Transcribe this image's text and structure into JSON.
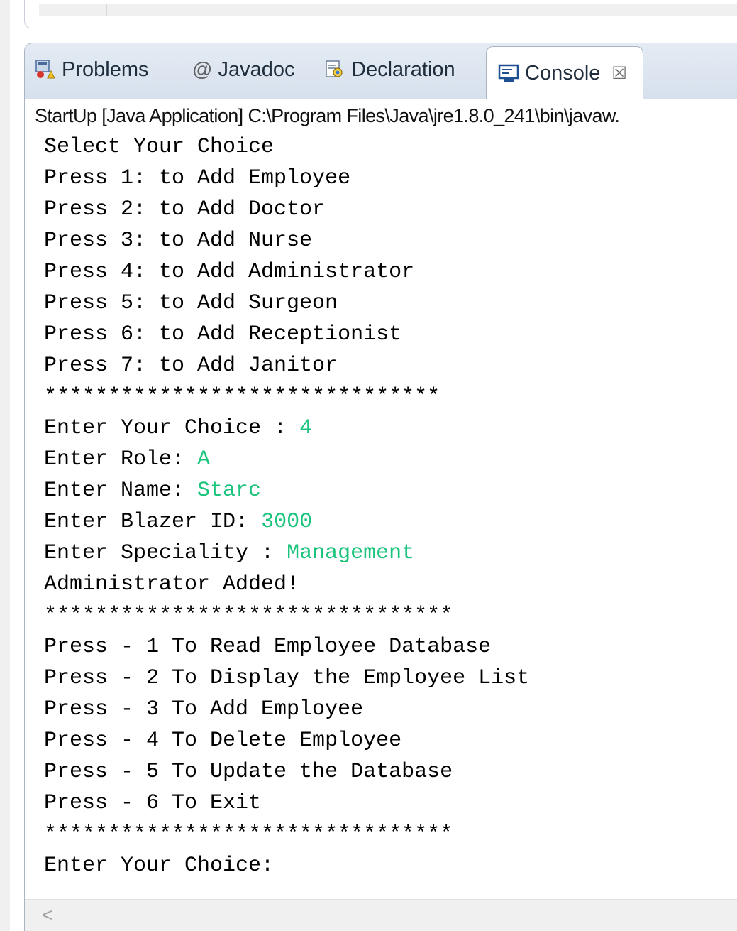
{
  "tabs": {
    "problems": "Problems",
    "javadoc": "Javadoc",
    "declaration": "Declaration",
    "console": "Console",
    "console_close": "☒"
  },
  "console": {
    "launch": "StartUp [Java Application] C:\\Program Files\\Java\\jre1.8.0_241\\bin\\javaw.",
    "lines": [
      {
        "text": "Select Your Choice",
        "input": ""
      },
      {
        "text": "Press 1: to Add Employee",
        "input": ""
      },
      {
        "text": "Press 2: to Add Doctor",
        "input": ""
      },
      {
        "text": "Press 3: to Add Nurse",
        "input": ""
      },
      {
        "text": "Press 4: to Add Administrator",
        "input": ""
      },
      {
        "text": "Press 5: to Add Surgeon",
        "input": ""
      },
      {
        "text": "Press 6: to Add Receptionist",
        "input": ""
      },
      {
        "text": "Press 7: to Add Janitor",
        "input": ""
      },
      {
        "text": "*******************************",
        "input": ""
      },
      {
        "text": "Enter Your Choice : ",
        "input": "4"
      },
      {
        "text": "Enter Role: ",
        "input": "A"
      },
      {
        "text": "Enter Name: ",
        "input": "Starc"
      },
      {
        "text": "Enter Blazer ID: ",
        "input": "3000"
      },
      {
        "text": "Enter Speciality : ",
        "input": "Management"
      },
      {
        "text": "Administrator Added!",
        "input": ""
      },
      {
        "text": "********************************",
        "input": ""
      },
      {
        "text": "Press - 1 To Read Employee Database",
        "input": ""
      },
      {
        "text": "Press - 2 To Display the Employee List",
        "input": ""
      },
      {
        "text": "Press - 3 To Add Employee",
        "input": ""
      },
      {
        "text": "Press - 4 To Delete Employee",
        "input": ""
      },
      {
        "text": "Press - 5 To Update the Database",
        "input": ""
      },
      {
        "text": "Press - 6 To Exit",
        "input": ""
      },
      {
        "text": "********************************",
        "input": ""
      },
      {
        "text": "Enter Your Choice: ",
        "input": ""
      }
    ]
  },
  "scroll_left_arrow": "<",
  "colors": {
    "user_input": "#1bc47d",
    "tabbar": "#dbe4ef"
  }
}
